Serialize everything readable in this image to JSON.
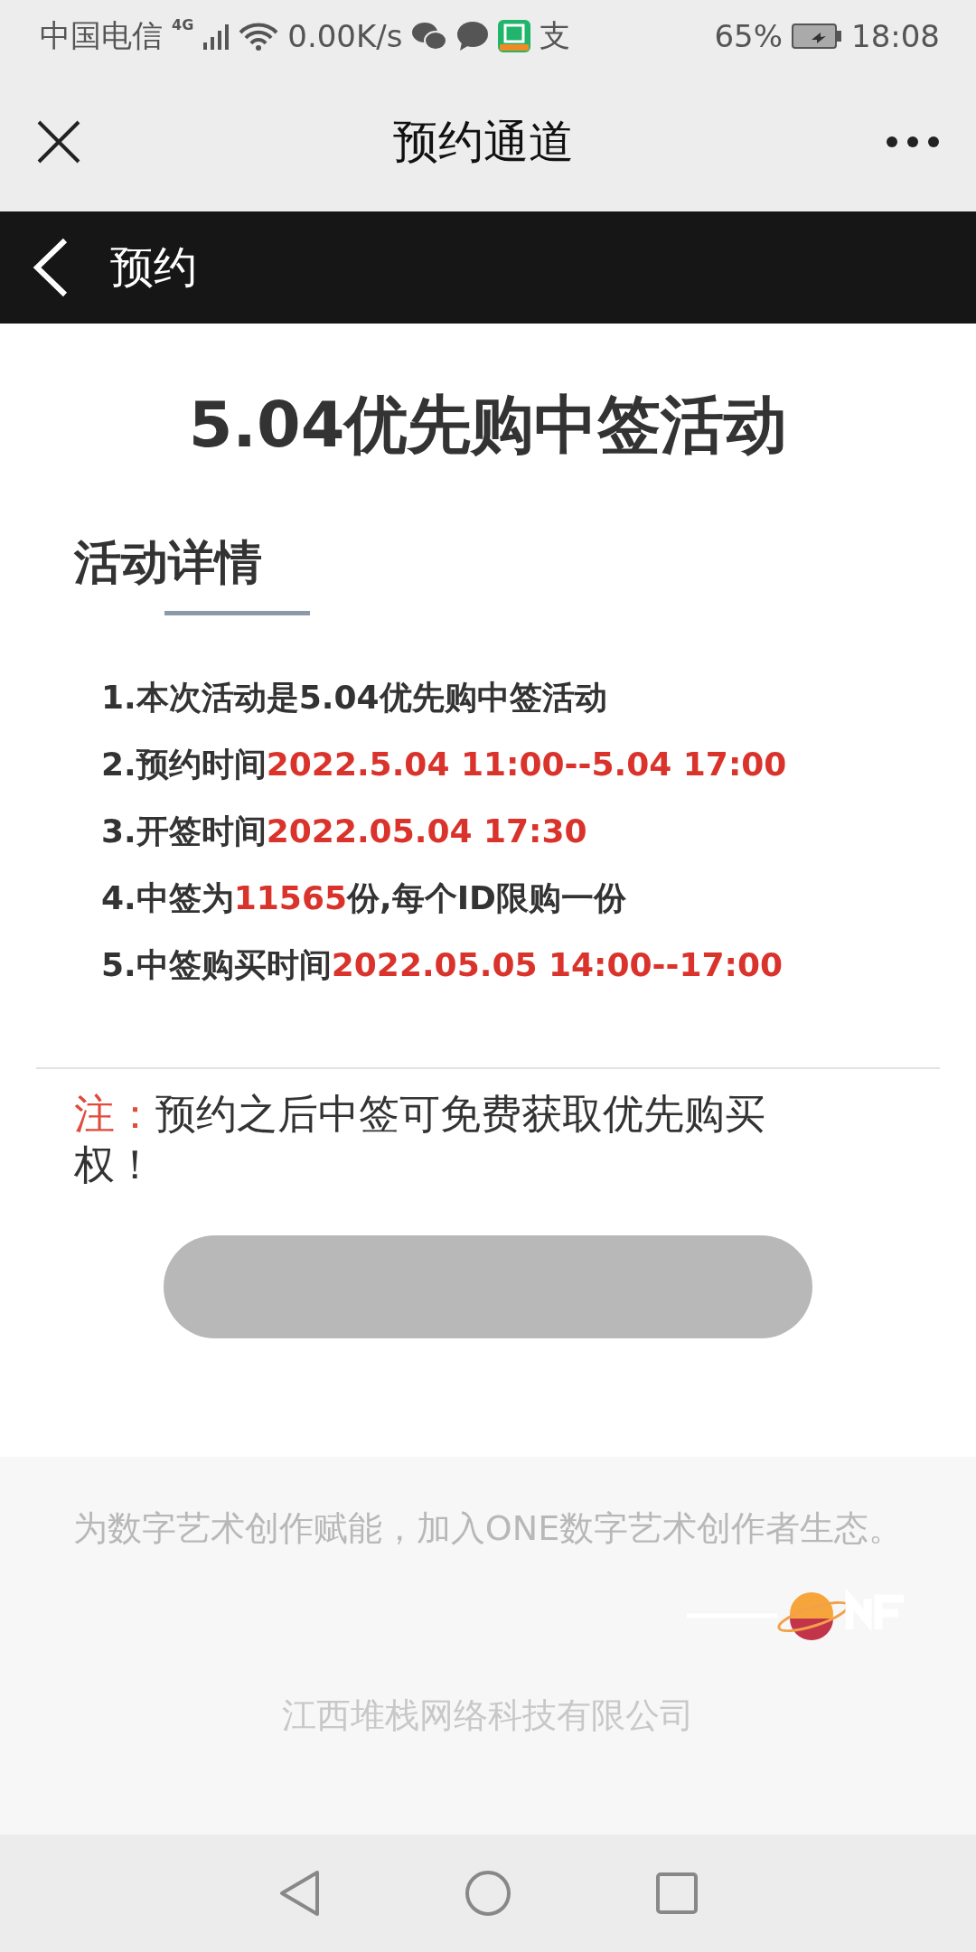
{
  "status_bar": {
    "carrier": "中国电信",
    "network": "4G",
    "speed": "0.00K/s",
    "alipay_glyph": "支",
    "battery": "65%",
    "time": "18:08"
  },
  "title_bar": {
    "title": "预约通道"
  },
  "nav_bar": {
    "title": "预约"
  },
  "page": {
    "heading": "5.04优先购中签活动",
    "section_title": "活动详情",
    "items": [
      {
        "text": "1.本次活动是5.04优先购中签活动"
      },
      {
        "text": "2.预约时间",
        "highlight": "2022.5.04 11:00--5.04  17:00"
      },
      {
        "text": "3.开签时间",
        "highlight": "2022.05.04 17:30"
      },
      {
        "text": "4.中签为",
        "highlight": "11565",
        "after": "份,每个ID限购一份"
      },
      {
        "text": "5.中签购买时间",
        "highlight": "2022.05.05 14:00--17:00"
      }
    ],
    "note": {
      "label": "注：",
      "text": "预约之后中签可免费获取优先购买权！"
    },
    "button": {
      "disabled": true
    }
  },
  "footer": {
    "slogan": "为数字艺术创作赋能，加入ONE数字艺术创作者生态。",
    "company": "江西堆栈网络科技有限公司"
  }
}
